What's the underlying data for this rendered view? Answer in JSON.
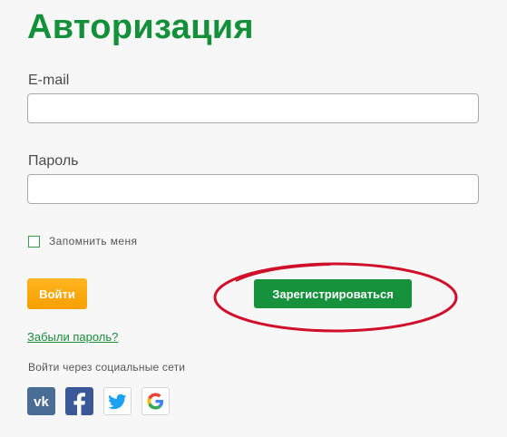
{
  "page": {
    "title": "Авторизация"
  },
  "form": {
    "email_label": "E-mail",
    "email_value": "",
    "password_label": "Пароль",
    "password_value": "",
    "remember_label": "Запомнить меня",
    "remember_checked": false,
    "login_button": "Войти",
    "register_button": "Зарегистрироваться",
    "forgot_link": "Забыли пароль?"
  },
  "social": {
    "title": "Войти через социальные сети",
    "networks": [
      "vk-icon",
      "facebook-icon",
      "twitter-icon",
      "google-icon"
    ]
  },
  "colors": {
    "brand_green": "#15903a",
    "login_orange": "#f7a000",
    "highlight_red": "#d0102a",
    "vk": "#4a6d96",
    "facebook": "#3b5998",
    "twitter": "#1da1f2"
  }
}
